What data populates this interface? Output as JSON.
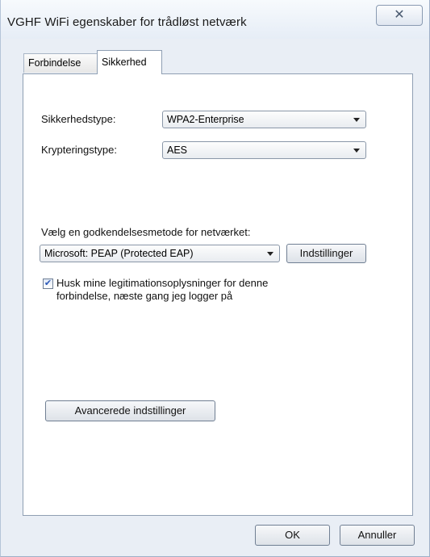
{
  "window": {
    "title": "VGHF WiFi egenskaber for trådløst netværk",
    "close_label": "✕"
  },
  "tabs": [
    {
      "label": "Forbindelse",
      "active": false
    },
    {
      "label": "Sikkerhed",
      "active": true
    }
  ],
  "security": {
    "security_type_label": "Sikkerhedstype:",
    "security_type_value": "WPA2-Enterprise",
    "encryption_type_label": "Krypteringstype:",
    "encryption_type_value": "AES",
    "auth_method_prompt": "Vælg en godkendelsesmetode for netværket:",
    "auth_method_value": "Microsoft: PEAP (Protected EAP)",
    "settings_button": "Indstillinger",
    "remember_credentials_checked": true,
    "remember_credentials_check_glyph": "✔",
    "remember_credentials_line1": "Husk mine legitimationsoplysninger for denne",
    "remember_credentials_line2": "forbindelse, næste gang jeg logger på",
    "advanced_button": "Avancerede indstillinger"
  },
  "footer": {
    "ok_label": "OK",
    "cancel_label": "Annuller"
  }
}
